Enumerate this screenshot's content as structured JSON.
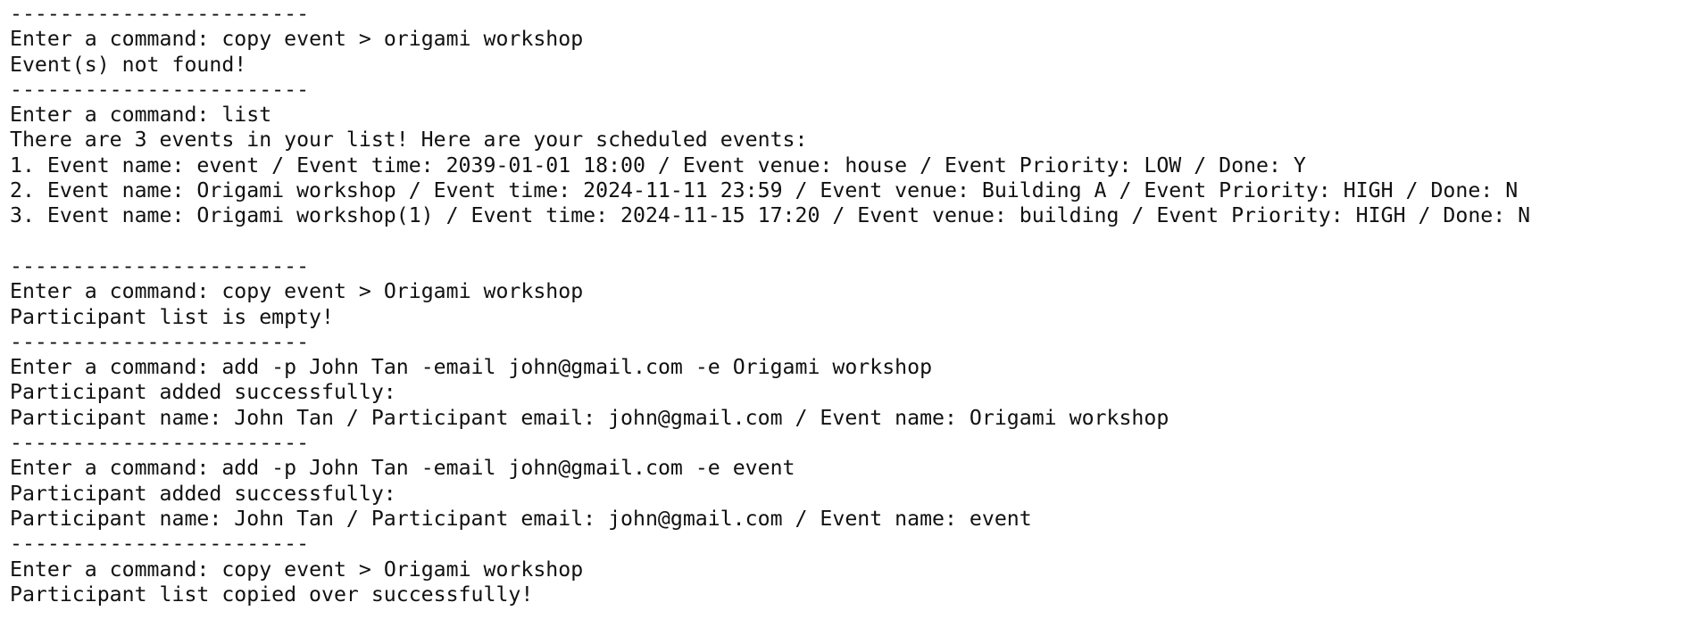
{
  "terminal": {
    "separator": "------------------------",
    "prompt_label": "Enter a command:",
    "blocks": [
      {
        "command": "copy event > origami workshop",
        "output": [
          "Event(s) not found!"
        ]
      },
      {
        "command": "list",
        "output": [
          "There are 3 events in your list! Here are your scheduled events:",
          "1. Event name: event / Event time: 2039-01-01 18:00 / Event venue: house / Event Priority: LOW / Done: Y",
          "2. Event name: Origami workshop / Event time: 2024-11-11 23:59 / Event venue: Building A / Event Priority: HIGH / Done: N",
          "3. Event name: Origami workshop(1) / Event time: 2024-11-15 17:20 / Event venue: building / Event Priority: HIGH / Done: N",
          ""
        ]
      },
      {
        "command": "copy event > Origami workshop",
        "output": [
          "Participant list is empty!"
        ]
      },
      {
        "command": "add -p John Tan -email john@gmail.com -e Origami workshop",
        "output": [
          "Participant added successfully:",
          "Participant name: John Tan / Participant email: john@gmail.com / Event name: Origami workshop"
        ]
      },
      {
        "command": "add -p John Tan -email john@gmail.com -e event",
        "output": [
          "Participant added successfully:",
          "Participant name: John Tan / Participant email: john@gmail.com / Event name: event"
        ]
      },
      {
        "command": "copy event > Origami workshop",
        "output": [
          "Participant list copied over successfully!"
        ]
      }
    ]
  }
}
